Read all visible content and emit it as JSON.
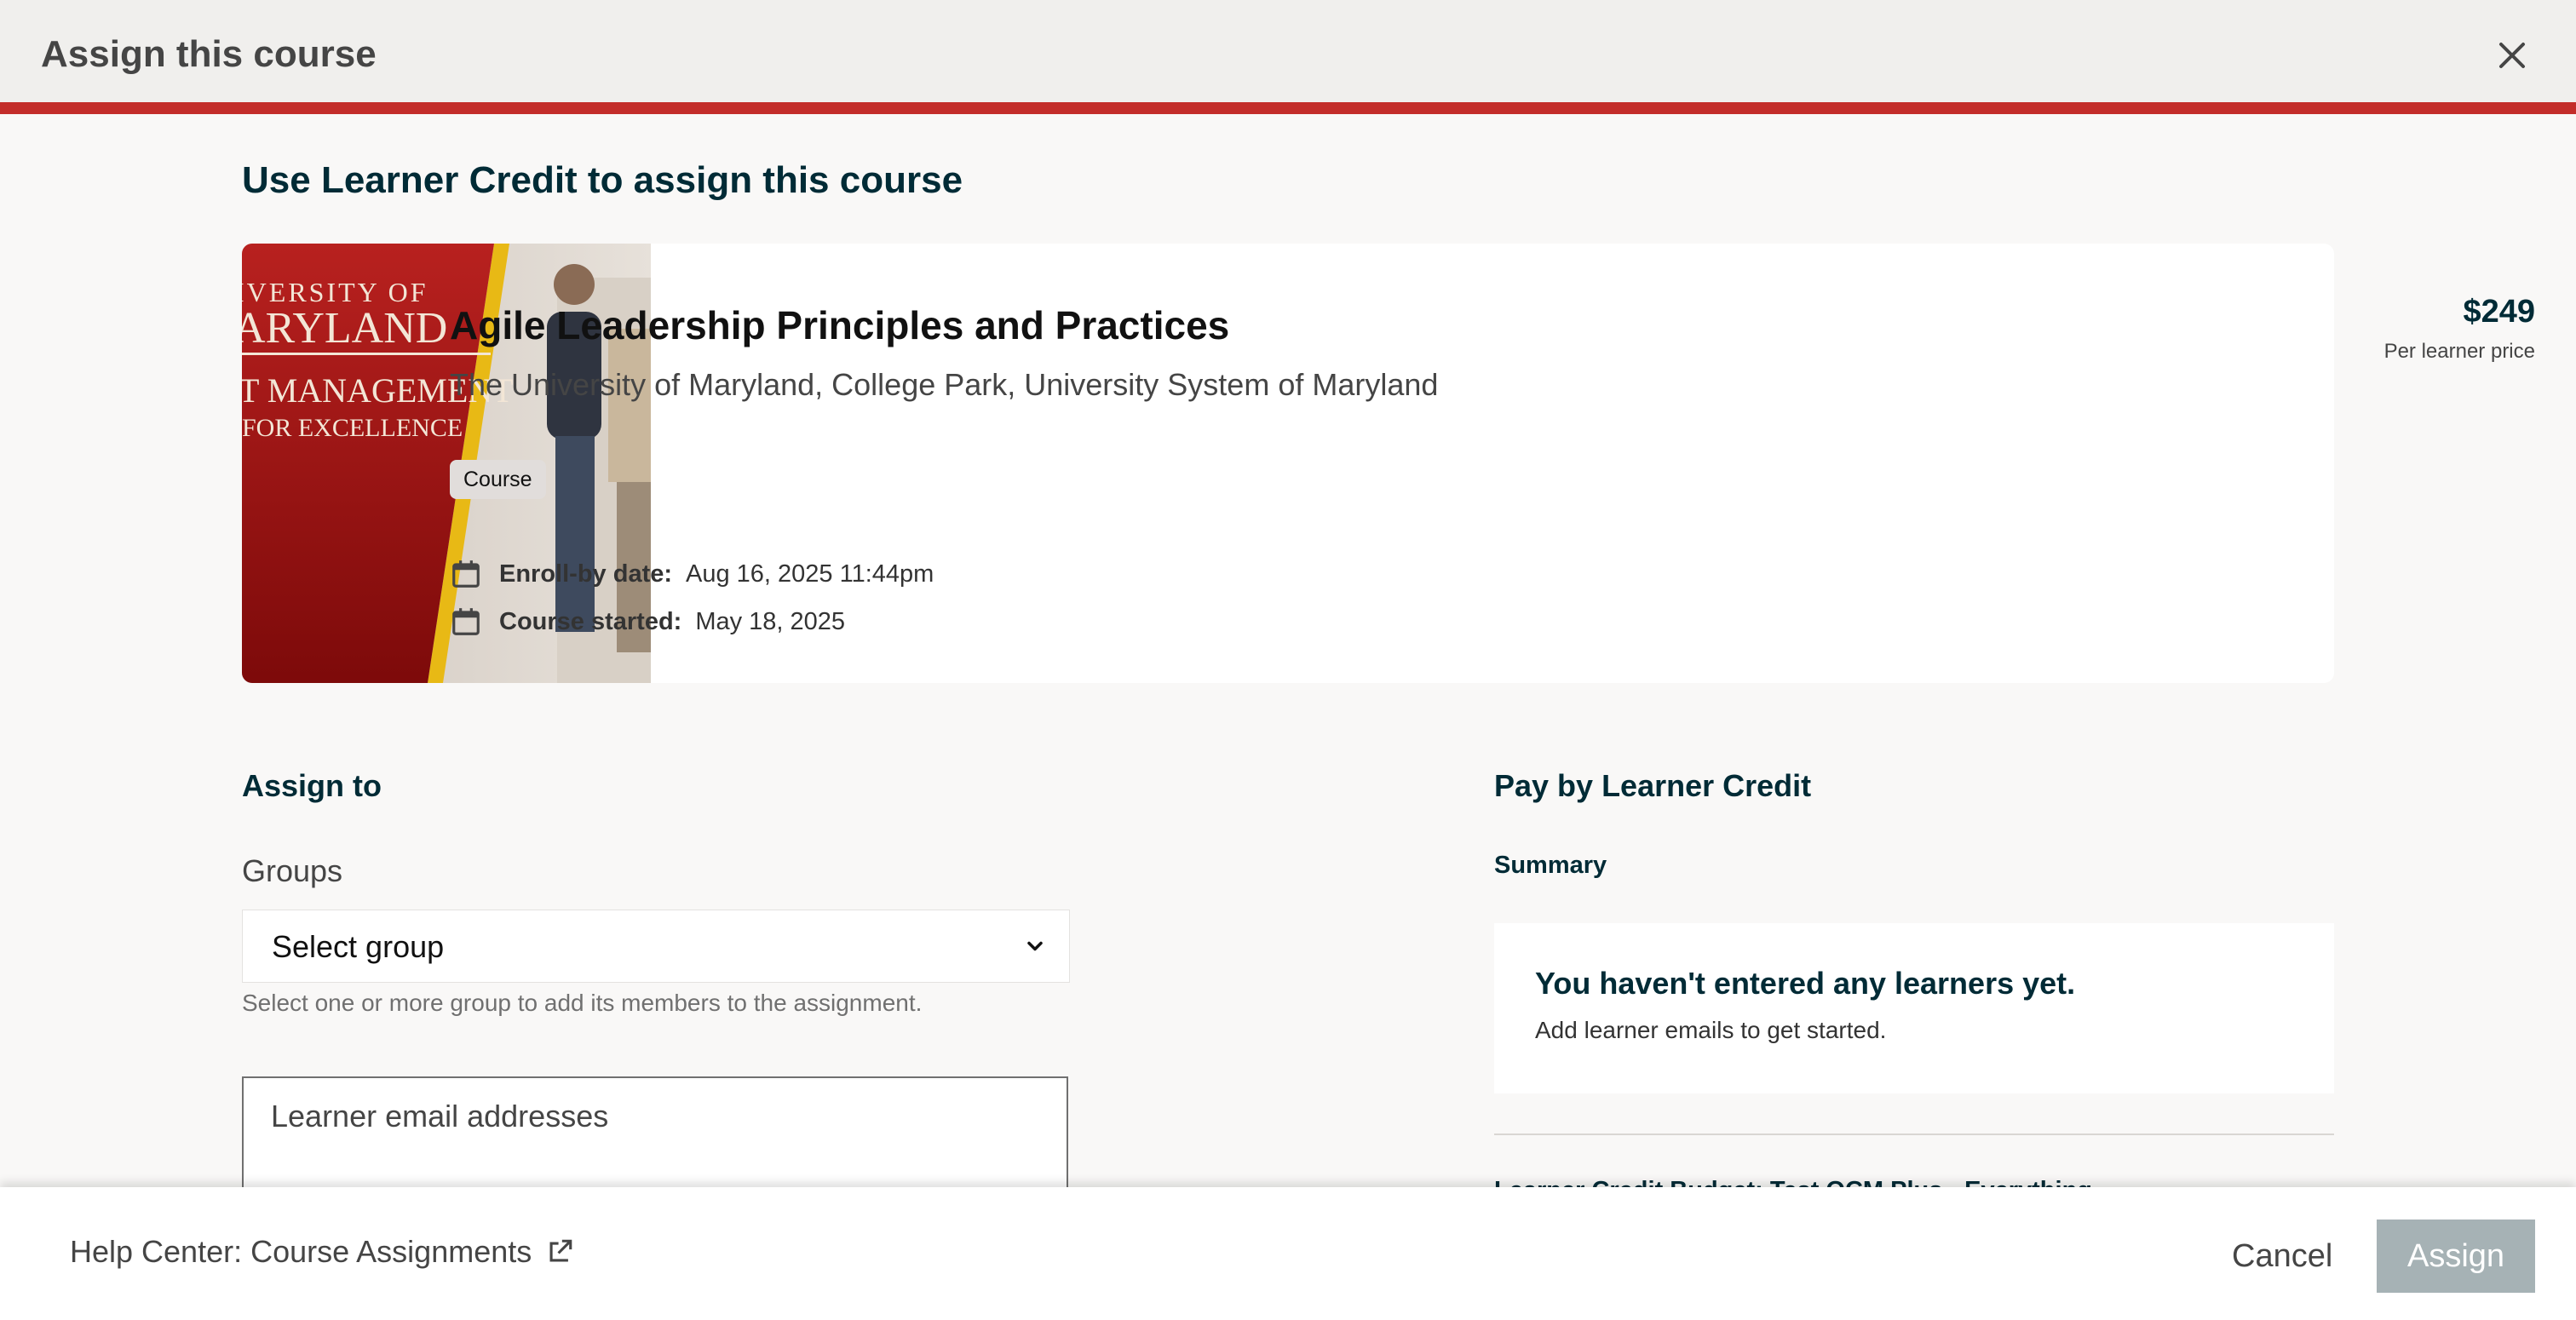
{
  "header": {
    "title": "Assign this course",
    "close_icon": "close-icon"
  },
  "colors": {
    "accent_bar": "#c32d2a",
    "heading": "#002b36",
    "assign_disabled": "#a6b2b5",
    "maryland_red": "#b1201f"
  },
  "page_heading": "Use Learner Credit to assign this course",
  "course": {
    "image_text": {
      "line1": "IVERSITY OF",
      "line2": "ARYLAND",
      "line3": "T MANAGEMENT",
      "line4": "FOR EXCELLENCE"
    },
    "title": "Agile Leadership Principles and Practices",
    "org": "The University of Maryland, College Park, University System of Maryland",
    "badge": "Course",
    "price": "$249",
    "price_label": "Per learner price",
    "enroll_by_label": "Enroll-by date:",
    "enroll_by_value": "Aug 16, 2025 11:44pm",
    "started_label": "Course started:",
    "started_value": "May 18, 2025",
    "date_icon": "calendar-icon"
  },
  "assign_to": {
    "heading": "Assign to",
    "groups_label": "Groups",
    "select_value": "Select group",
    "select_icon": "chevron-down-icon",
    "helper": "Select one or more group to add its members to the assignment.",
    "email_placeholder": "Learner email addresses"
  },
  "payment": {
    "heading": "Pay by Learner Credit",
    "summary_label": "Summary",
    "summary_title": "You haven't entered any learners yet.",
    "summary_sub": "Add learner emails to get started.",
    "budget_partial": "Learner Credit Budget: Test OCM Plus - Everything"
  },
  "footer": {
    "help_link": "Help Center: Course Assignments",
    "help_icon": "external-link-icon",
    "cancel": "Cancel",
    "assign": "Assign"
  }
}
